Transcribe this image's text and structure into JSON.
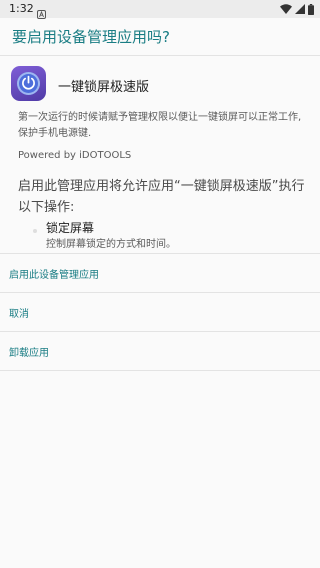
{
  "status_bar": {
    "time": "1:32",
    "icons": [
      "notification-a-icon",
      "wifi-icon",
      "signal-icon",
      "battery-icon"
    ]
  },
  "dialog": {
    "title": "要启用设备管理应用吗?",
    "app": {
      "name": "一键锁屏极速版",
      "icon": "power-icon"
    },
    "description": "第一次运行的时候请赋予管理权限以便让一键锁屏可以正常工作,保护手机电源键.",
    "powered_by": "Powered by iDOTOOLS",
    "permission_intro": "启用此管理应用将允许应用“一键锁屏极速版”执行以下操作:",
    "permissions": [
      {
        "title": "锁定屏幕",
        "description": "控制屏幕锁定的方式和时间。"
      }
    ],
    "actions": {
      "activate": "启用此设备管理应用",
      "cancel": "取消",
      "uninstall": "卸载应用"
    }
  },
  "colors": {
    "accent": "#1a7d84",
    "background": "#fafafa",
    "status_bar": "#ececec",
    "app_icon": "#5b45b8"
  }
}
